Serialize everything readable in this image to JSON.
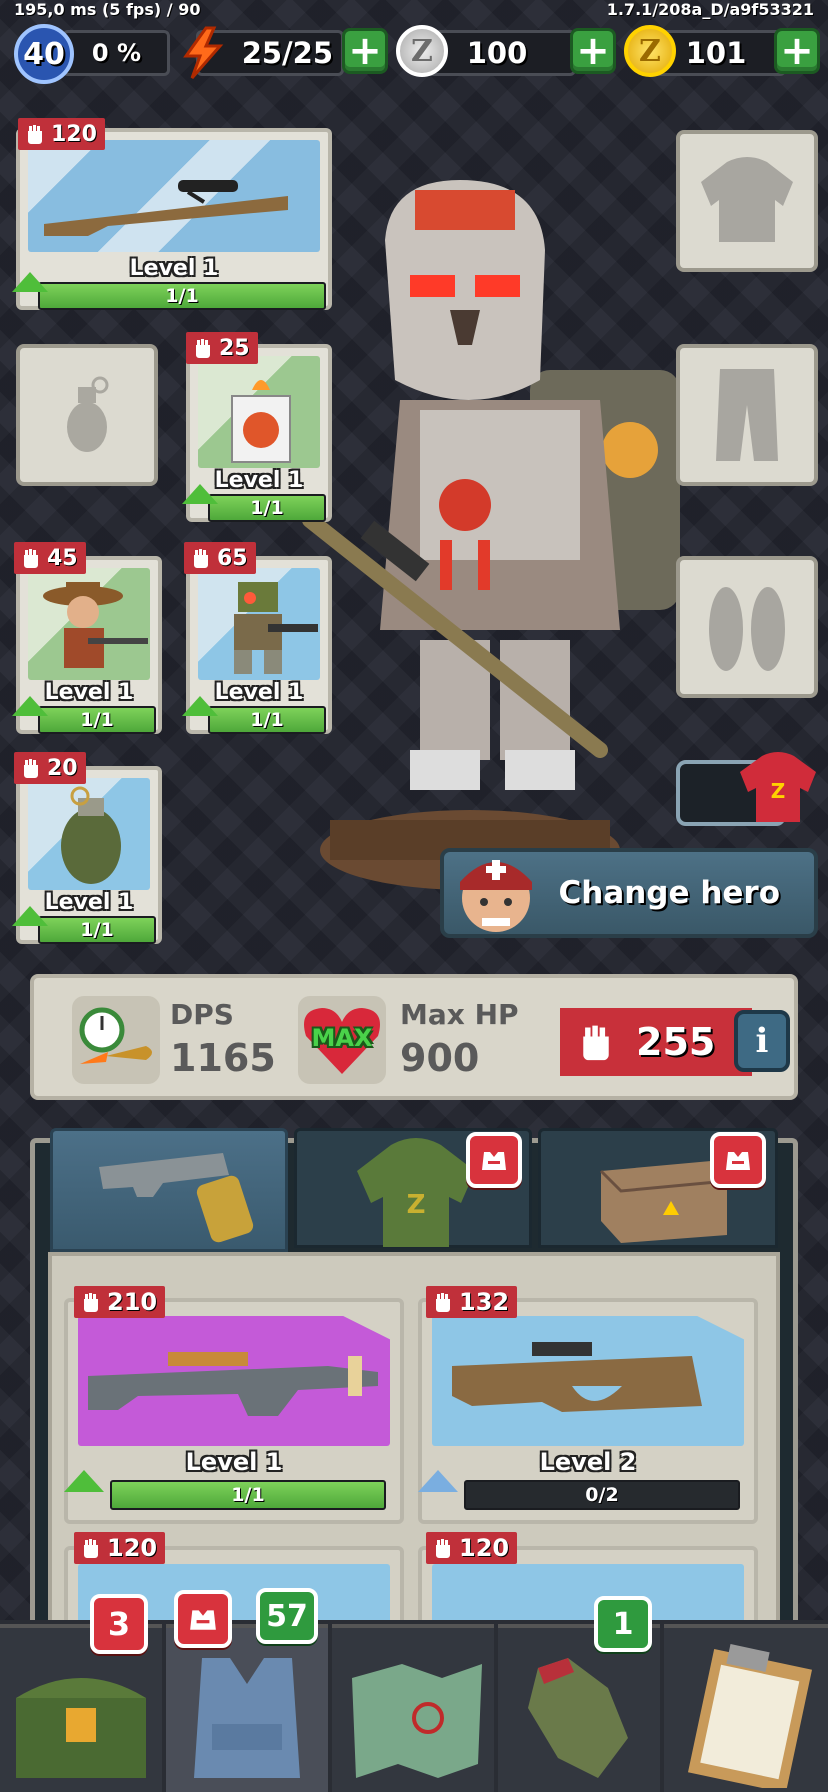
{
  "debug": {
    "fps_text": "195,0 ms (5 fps) / 90",
    "version": "1.7.1/208a_D/a9f53321"
  },
  "topbar": {
    "player_level": "40",
    "xp_percent": "0 %",
    "energy": "25/25",
    "silver_coin_symbol": "Z",
    "silver": "100",
    "gold_coin_symbol": "Z",
    "gold": "101",
    "plus": "+",
    "colors": {
      "gold": "#f2c400",
      "silver": "#c9c9c9",
      "green": "#3aa040"
    }
  },
  "equipped": [
    {
      "power": "120",
      "level": "Level 1",
      "progress": "1/1",
      "item": "sniper-rifle"
    },
    {
      "power": "25",
      "level": "Level 1",
      "progress": "1/1",
      "item": "fire-lighter"
    },
    {
      "power": "45",
      "level": "Level 1",
      "progress": "1/1",
      "item": "cowboy-companion"
    },
    {
      "power": "65",
      "level": "Level 1",
      "progress": "1/1",
      "item": "robot-companion"
    },
    {
      "power": "20",
      "level": "Level 1",
      "progress": "1/1",
      "item": "grenade"
    }
  ],
  "change_hero": {
    "label": "Change hero"
  },
  "stats": {
    "dps_label": "DPS",
    "dps_value": "1165",
    "hp_badge": "MAX",
    "hp_label": "Max HP",
    "hp_value": "900",
    "total_power": "255",
    "info_symbol": "i"
  },
  "inventory_tabs": [
    {
      "name": "weapons",
      "icon": "pistol-icon"
    },
    {
      "name": "clothing",
      "icon": "hoodie-icon"
    },
    {
      "name": "boxes",
      "icon": "box-icon"
    }
  ],
  "inventory": [
    {
      "power": "210",
      "level": "Level 1",
      "progress": "1/1",
      "progress_fraction": 1,
      "bg": "#c45ad8"
    },
    {
      "power": "132",
      "level": "Level 2",
      "progress": "0/2",
      "progress_fraction": 0,
      "bg": "#8ec6e6"
    },
    {
      "power": "120"
    },
    {
      "power": "120"
    }
  ],
  "bottom_nav": {
    "chest_badge": "3",
    "vest_badge": "57",
    "glove_badge": "1"
  }
}
